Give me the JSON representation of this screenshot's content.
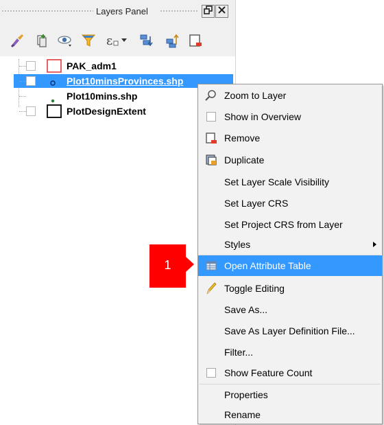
{
  "panel": {
    "title": "Layers Panel",
    "float_button": "🗗",
    "close_button": "✕"
  },
  "toolbar": {
    "icons": [
      "open-layer-styling-icon",
      "add-group-icon",
      "manage-visibility-icon",
      "filter-legend-icon",
      "filter-expression-icon",
      "expand-all-icon",
      "collapse-all-icon",
      "remove-layer-icon"
    ]
  },
  "layers": [
    {
      "name": "PAK_adm1",
      "symbol": "polygon-red-outline",
      "selected": false
    },
    {
      "name": "Plot10minsProvinces.shp",
      "symbol": "point-circle",
      "selected": true
    },
    {
      "name": "Plot10mins.shp",
      "symbol": "point-dot-green",
      "selected": false
    },
    {
      "name": "PlotDesignExtent",
      "symbol": "polygon-black-outline",
      "selected": false
    }
  ],
  "context_menu": {
    "items": [
      {
        "label": "Zoom to Layer",
        "icon": "zoom-icon"
      },
      {
        "label": "Show in Overview",
        "icon": "checkbox"
      },
      {
        "label": "Remove",
        "icon": "remove-layer-icon"
      },
      {
        "label": "Duplicate",
        "icon": "duplicate-layer-icon"
      },
      {
        "label": "Set Layer Scale Visibility",
        "icon": ""
      },
      {
        "label": "Set Layer CRS",
        "icon": ""
      },
      {
        "label": "Set Project CRS from Layer",
        "icon": ""
      },
      {
        "label": "Styles",
        "icon": "",
        "submenu": true
      },
      {
        "label": "Open Attribute Table",
        "icon": "attribute-table-icon",
        "highlighted": true
      },
      {
        "label": "Toggle Editing",
        "icon": "pencil-icon"
      },
      {
        "label": "Save As...",
        "icon": ""
      },
      {
        "label": "Save As Layer Definition File...",
        "icon": ""
      },
      {
        "label": "Filter...",
        "icon": ""
      },
      {
        "label": "Show Feature Count",
        "icon": "checkbox"
      },
      {
        "label": "Properties",
        "icon": ""
      },
      {
        "label": "Rename",
        "icon": ""
      }
    ]
  },
  "step_badge": {
    "number": "1",
    "color": "#ff0000"
  },
  "colors": {
    "highlight": "#3399ff",
    "menu_bg": "#f2f2f2"
  }
}
